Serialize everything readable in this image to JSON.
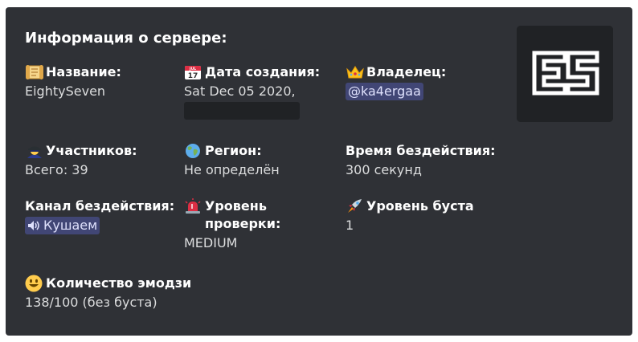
{
  "embed": {
    "title": "Информация о сервере:",
    "accent_color": "#2f3136",
    "thumbnail_logo": "ES",
    "fields": {
      "name": {
        "icon": "scroll-icon",
        "label": "Название:",
        "value": "EightySeven"
      },
      "created": {
        "icon": "calendar-icon",
        "label": "Дата создания:",
        "value": "Sat Dec 05 2020,",
        "calendar_text": "JUL 17"
      },
      "owner": {
        "icon": "crown-icon",
        "label": "Владелец:",
        "value": "@ka4ergaa"
      },
      "members": {
        "icon": "detective-icon",
        "label": "Участников:",
        "value": "Всего: 39"
      },
      "region": {
        "icon": "globe-icon",
        "label": "Регион:",
        "value": "Не определён"
      },
      "afk_timeout": {
        "label": "Время бездействия:",
        "value": "300 секунд"
      },
      "afk_channel": {
        "label": "Канал бездействия:",
        "value": "Кушаем"
      },
      "verification": {
        "icon": "siren-icon",
        "label": "Уровень проверки:",
        "value": "MEDIUM"
      },
      "boost": {
        "icon": "rocket-icon",
        "label": "Уровень буста",
        "value": "1"
      },
      "emoji": {
        "icon": "smiley-icon",
        "label": "Количество эмодзи",
        "value": "138/100 (без буста)"
      }
    }
  }
}
